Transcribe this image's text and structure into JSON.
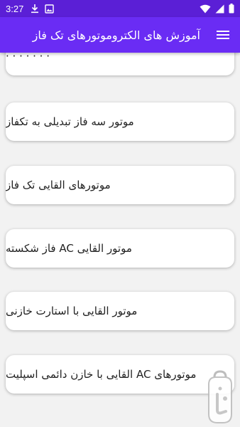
{
  "status_bar": {
    "time": "3:27",
    "left_icons": [
      "download-icon",
      "image-icon"
    ],
    "right_icons": [
      "wifi-icon",
      "signal-icon",
      "battery-icon"
    ]
  },
  "app_bar": {
    "title": "آموزش های الکتروموتورهای تک فاز",
    "menu_icon": "hamburger-menu-icon"
  },
  "list": {
    "partial_item": "· · · · · · ·",
    "items": [
      {
        "label": "موتور سه فاز تبدیلی به تکفاز"
      },
      {
        "label": "موتورهای القایی تک فاز"
      },
      {
        "label": "موتور القایی AC فاز شکسته"
      },
      {
        "label": "موتور القایی با استارت خازنی"
      },
      {
        "label": "موتورهای AC القایی با خازن دائمی اسپلیت"
      }
    ]
  },
  "colors": {
    "status_bar": "#5b1fd6",
    "app_bar": "#6a2cf4",
    "background": "#f2f2f2",
    "card": "#ffffff"
  }
}
